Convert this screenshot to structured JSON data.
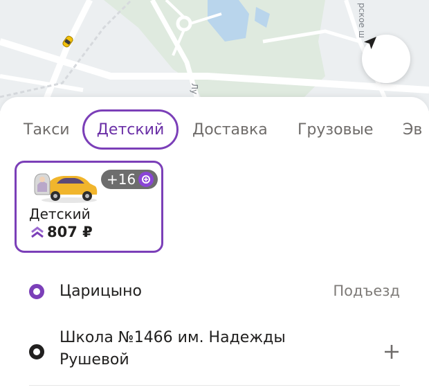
{
  "map": {
    "street_labels": [
      "рское ш",
      "Лу"
    ],
    "locate_icon": "navigation-arrow-icon",
    "taxi_icon": "taxi-car-icon"
  },
  "tabs": [
    {
      "label": "Такси",
      "selected": false
    },
    {
      "label": "Детский",
      "selected": true
    },
    {
      "label": "Доставка",
      "selected": false
    },
    {
      "label": "Грузовые",
      "selected": false
    },
    {
      "label": "Эв",
      "selected": false
    }
  ],
  "tariff": {
    "name": "Детский",
    "price": "807 ₽",
    "badge": "+16",
    "badge_icon": "plus-points-icon",
    "price_icon": "surge-chevrons-icon"
  },
  "route": {
    "from": "Царицыно",
    "entrance_label": "Подъезд",
    "to_line1": "Школа №1466 им. Надежды",
    "to_line2": "Рушевой",
    "add_icon": "plus-icon"
  },
  "colors": {
    "accent": "#7b3fb8",
    "badge_bg": "#6d6d6d",
    "text": "#21201f",
    "muted": "#6f6c6a"
  }
}
